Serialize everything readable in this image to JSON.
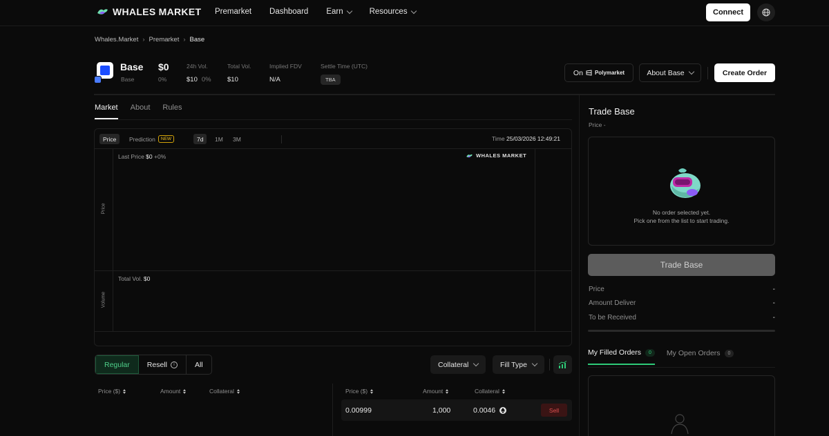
{
  "header": {
    "brand": "WHALES MARKET",
    "nav": [
      {
        "label": "Premarket",
        "dropdown": false
      },
      {
        "label": "Dashboard",
        "dropdown": false
      },
      {
        "label": "Earn",
        "dropdown": true
      },
      {
        "label": "Resources",
        "dropdown": true
      }
    ],
    "connect_label": "Connect"
  },
  "breadcrumb": [
    "Whales.Market",
    "Premarket",
    "Base"
  ],
  "token": {
    "name": "Base",
    "symbol": "Base",
    "price": "$0",
    "price_change": "0%",
    "vol24h_label": "24h Vol.",
    "vol24h_value": "$10",
    "vol24h_change": "0%",
    "total_vol_label": "Total Vol.",
    "total_vol_value": "$10",
    "fdv_label": "Implied FDV",
    "fdv_value": "N/A",
    "settle_label": "Settle Time (UTC)",
    "settle_value": "TBA"
  },
  "actions": {
    "on_label": "On",
    "polymarket_label": "Polymarket",
    "about_label": "About Base",
    "create_label": "Create Order"
  },
  "tabs": [
    "Market",
    "About",
    "Rules"
  ],
  "chart": {
    "mode_price": "Price",
    "mode_prediction": "Prediction",
    "new_badge": "NEW",
    "ranges": [
      "7d",
      "1M",
      "3M"
    ],
    "time_label": "Time",
    "time_value": "25/03/2026 12:49:21",
    "last_price_label": "Last Price",
    "last_price_value": "$0",
    "last_price_change": "+0%",
    "total_vol_label": "Total Vol.",
    "total_vol_value": "$0",
    "price_axis": "Price",
    "volume_axis": "Volume",
    "watermark": "WHALES MARKET"
  },
  "filters": {
    "segments": [
      "Regular",
      "Resell",
      "All"
    ],
    "collateral": "Collateral",
    "fill_type": "Fill Type"
  },
  "orders": {
    "columns": [
      "Price ($)",
      "Amount",
      "Collateral"
    ],
    "rows": [
      {
        "price": "0.00999",
        "amount": "1,000",
        "collateral": "0.0046",
        "side": "Sell"
      }
    ]
  },
  "trade": {
    "title": "Trade Base",
    "price_label": "Price -",
    "empty_line1": "No order selected yet.",
    "empty_line2": "Pick one from the list to start trading.",
    "button": "Trade Base",
    "kv": [
      {
        "label": "Price",
        "value": "-"
      },
      {
        "label": "Amount Deliver",
        "value": "-"
      },
      {
        "label": "To be Received",
        "value": "-"
      }
    ],
    "order_tabs": [
      {
        "label": "My Filled Orders",
        "count": "0"
      },
      {
        "label": "My Open Orders",
        "count": "0"
      }
    ]
  }
}
